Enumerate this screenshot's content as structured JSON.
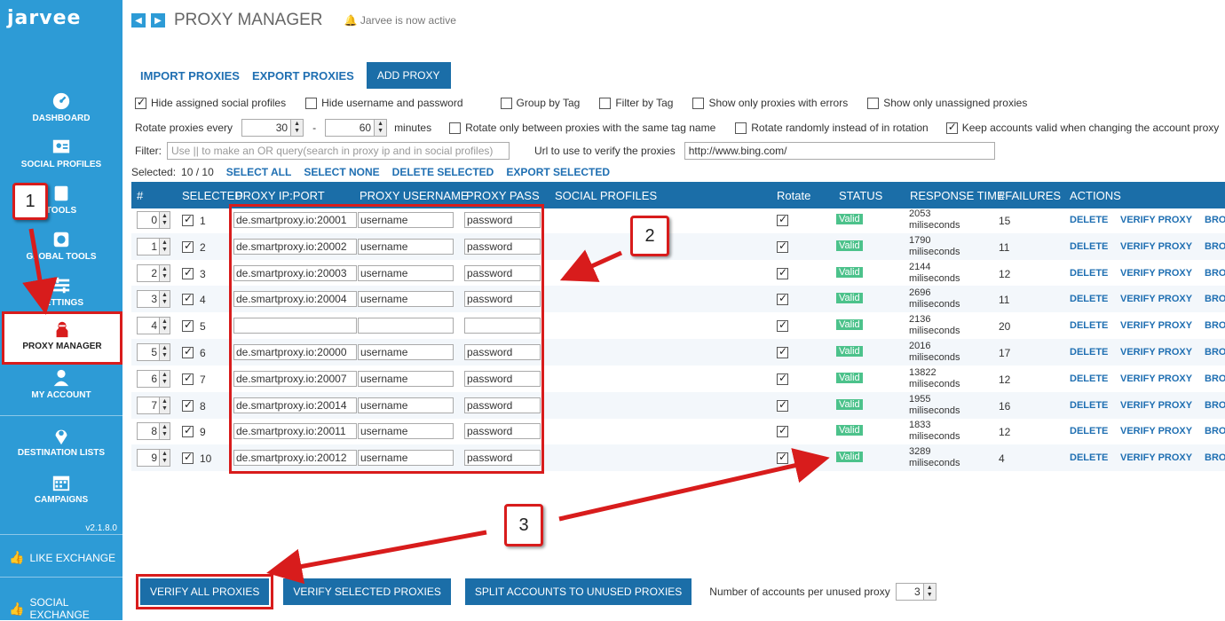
{
  "sidebar": {
    "logo": "jarvee",
    "items": [
      {
        "label": "DASHBOARD",
        "icon": "dashboard-icon"
      },
      {
        "label": "SOCIAL PROFILES",
        "icon": "profiles-icon"
      },
      {
        "label": "TOOLS",
        "icon": "tools-icon"
      },
      {
        "label": "GLOBAL TOOLS",
        "icon": "global-tools-icon"
      },
      {
        "label": "SETTINGS",
        "icon": "settings-icon"
      },
      {
        "label": "PROXY MANAGER",
        "icon": "proxy-icon"
      },
      {
        "label": "MY ACCOUNT",
        "icon": "account-icon"
      },
      {
        "label": "DESTINATION LISTS",
        "icon": "pin-icon"
      },
      {
        "label": "CAMPAIGNS",
        "icon": "calendar-icon"
      }
    ],
    "version": "v2.1.8.0",
    "like_exchange": "LIKE EXCHANGE",
    "social_exchange": "SOCIAL EXCHANGE"
  },
  "header": {
    "title": "PROXY MANAGER",
    "notice": "Jarvee is now active"
  },
  "toolbar": {
    "import": "IMPORT PROXIES",
    "export": "EXPORT PROXIES",
    "add": "ADD PROXY"
  },
  "options": {
    "hide_assigned": "Hide assigned social profiles",
    "hide_userpass": "Hide username and password",
    "group_tag": "Group by Tag",
    "filter_tag": "Filter by Tag",
    "only_errors": "Show only proxies with errors",
    "only_unassigned": "Show only unassigned proxies",
    "rotate_every": "Rotate proxies every",
    "rotate_min": "30",
    "rotate_max": "60",
    "dash": "-",
    "minutes": "minutes",
    "rotate_same_tag": "Rotate only between proxies with the same tag name",
    "rotate_random": "Rotate randomly instead of in rotation",
    "keep_valid": "Keep accounts valid when changing the account proxy",
    "filter_label": "Filter:",
    "filter_placeholder": "Use || to make an OR query(search in proxy ip and in social profiles)",
    "url_label": "Url to use to verify the proxies",
    "url_value": "http://www.bing.com/"
  },
  "selection": {
    "label": "Selected:",
    "count": "10 / 10",
    "select_all": "SELECT ALL",
    "select_none": "SELECT NONE",
    "delete_selected": "DELETE SELECTED",
    "export_selected": "EXPORT SELECTED"
  },
  "table": {
    "headers": [
      "#",
      "SELECTED",
      "PROXY IP:PORT",
      "PROXY USERNAME",
      "PROXY PASS",
      "SOCIAL PROFILES",
      "Rotate",
      "STATUS",
      "RESPONSE TIME",
      "#FAILURES",
      "ACTIONS"
    ],
    "rows": [
      {
        "idx": "0",
        "sel": "1",
        "ip": "de.smartproxy.io:20001",
        "user": "username",
        "pass": "password",
        "status": "Valid",
        "rt": "2053",
        "rt_unit": "miliseconds",
        "fail": "15"
      },
      {
        "idx": "1",
        "sel": "2",
        "ip": "de.smartproxy.io:20002",
        "user": "username",
        "pass": "password",
        "status": "Valid",
        "rt": "1790",
        "rt_unit": "miliseconds",
        "fail": "11"
      },
      {
        "idx": "2",
        "sel": "3",
        "ip": "de.smartproxy.io:20003",
        "user": "username",
        "pass": "password",
        "status": "Valid",
        "rt": "2144",
        "rt_unit": "miliseconds",
        "fail": "12"
      },
      {
        "idx": "3",
        "sel": "4",
        "ip": "de.smartproxy.io:20004",
        "user": "username",
        "pass": "password",
        "status": "Valid",
        "rt": "2696",
        "rt_unit": "miliseconds",
        "fail": "11"
      },
      {
        "idx": "4",
        "sel": "5",
        "ip": "",
        "user": "",
        "pass": "",
        "status": "Valid",
        "rt": "2136",
        "rt_unit": "miliseconds",
        "fail": "20"
      },
      {
        "idx": "5",
        "sel": "6",
        "ip": "de.smartproxy.io:20000",
        "user": "username",
        "pass": "password",
        "status": "Valid",
        "rt": "2016",
        "rt_unit": "miliseconds",
        "fail": "17"
      },
      {
        "idx": "6",
        "sel": "7",
        "ip": "de.smartproxy.io:20007",
        "user": "username",
        "pass": "password",
        "status": "Valid",
        "rt": "13822",
        "rt_unit": "miliseconds",
        "fail": "12"
      },
      {
        "idx": "7",
        "sel": "8",
        "ip": "de.smartproxy.io:20014",
        "user": "username",
        "pass": "password",
        "status": "Valid",
        "rt": "1955",
        "rt_unit": "miliseconds",
        "fail": "16"
      },
      {
        "idx": "8",
        "sel": "9",
        "ip": "de.smartproxy.io:20011",
        "user": "username",
        "pass": "password",
        "status": "Valid",
        "rt": "1833",
        "rt_unit": "miliseconds",
        "fail": "12"
      },
      {
        "idx": "9",
        "sel": "10",
        "ip": "de.smartproxy.io:20012",
        "user": "username",
        "pass": "password",
        "status": "Valid",
        "rt": "3289",
        "rt_unit": "miliseconds",
        "fail": "4"
      }
    ],
    "actions": {
      "delete": "DELETE",
      "verify": "VERIFY PROXY",
      "browse": "BRO"
    }
  },
  "bottom": {
    "verify_all": "VERIFY ALL PROXIES",
    "verify_selected": "VERIFY SELECTED PROXIES",
    "split": "SPLIT ACCOUNTS TO UNUSED PROXIES",
    "per_proxy_label": "Number of accounts per unused proxy",
    "per_proxy_value": "3"
  },
  "annotations": {
    "one": "1",
    "two": "2",
    "three": "3"
  },
  "colors": {
    "sidebar": "#2d9bd6",
    "header_bg": "#1b6ea8",
    "link": "#1f6fb2",
    "valid": "#4cc28b",
    "highlight": "#d81c1c"
  }
}
